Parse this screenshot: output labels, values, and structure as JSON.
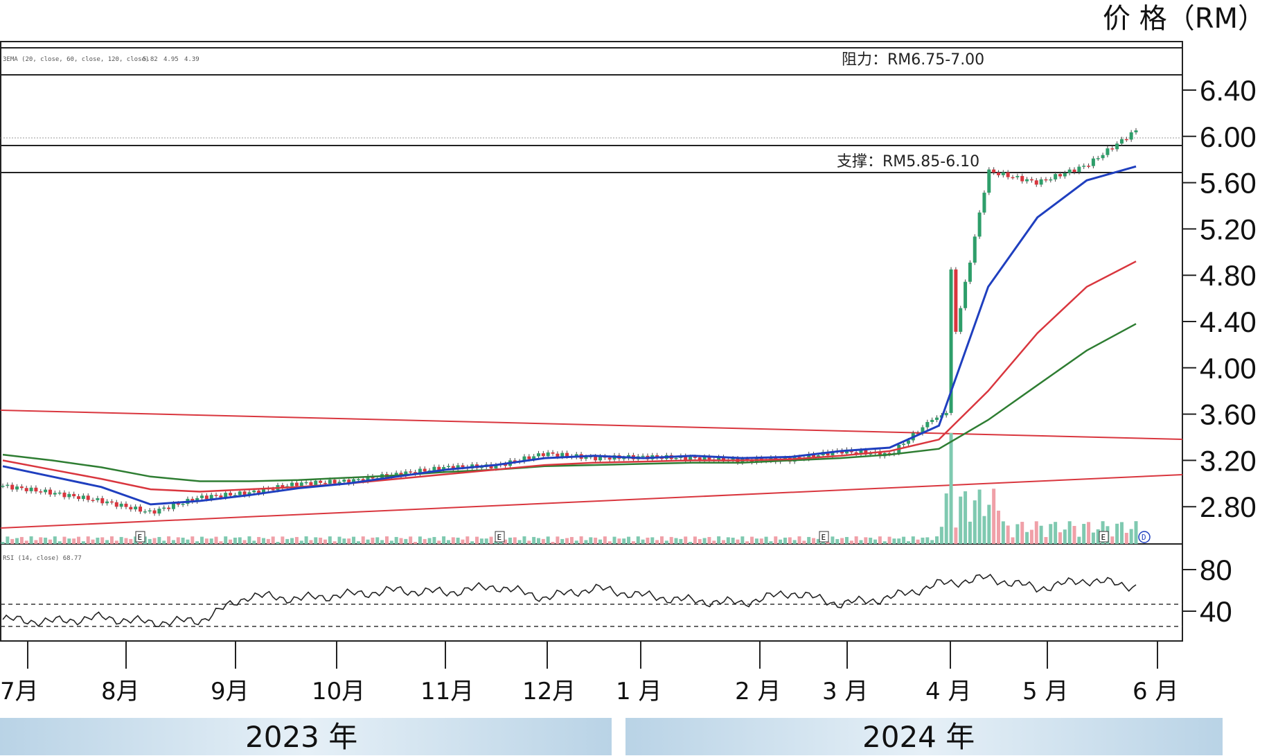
{
  "chart_data": {
    "type": "candlestick",
    "ylabel": "价 格（RM）",
    "y_ticks": [
      "6.40",
      "6.00",
      "5.60",
      "5.20",
      "4.80",
      "4.40",
      "4.00",
      "3.60",
      "3.20",
      "2.80"
    ],
    "rsi_ticks": [
      "80",
      "40"
    ],
    "rsi_legend": "RSI (14, close) 68.77",
    "ema_legend": {
      "text": "3EMA (20, close, 60, close, 120, close)",
      "v1": "5.82",
      "v2": "4.95",
      "v3": "4.39"
    },
    "resistance": {
      "label": "阻力：RM6.75-7.00",
      "low": 6.75,
      "high": 7.0
    },
    "support": {
      "label": "支撑：RM5.85-6.10",
      "low": 5.85,
      "high": 6.1
    },
    "months": [
      "7月",
      "8月",
      "9月",
      "10月",
      "11月",
      "12月",
      "1 月",
      "2 月",
      "3 月",
      "4 月",
      "5 月",
      "6 月"
    ],
    "years": [
      "2023 年",
      "2024 年"
    ],
    "earnings_marker": "E",
    "dividend_marker": "D",
    "colors": {
      "up": "#2e9e6a",
      "down": "#d9363e",
      "ema20": "#1f3fbf",
      "ema60": "#d9363e",
      "ema120": "#2e7d32",
      "volume_up": "#7fc9b0",
      "volume_down": "#f0a0a8",
      "year_band": "#b9d3e6"
    },
    "ema20_values": [
      3.15,
      3.06,
      2.97,
      2.82,
      2.85,
      2.9,
      2.96,
      3.0,
      3.06,
      3.12,
      3.16,
      3.22,
      3.24,
      3.22,
      3.24,
      3.22,
      3.23,
      3.28,
      3.31,
      3.5,
      4.7,
      5.3,
      5.62,
      5.74
    ],
    "ema60_values": [
      3.2,
      3.12,
      3.04,
      2.95,
      2.93,
      2.95,
      2.97,
      3.0,
      3.04,
      3.08,
      3.12,
      3.16,
      3.18,
      3.19,
      3.2,
      3.2,
      3.21,
      3.24,
      3.28,
      3.38,
      3.8,
      4.3,
      4.7,
      4.92
    ],
    "ema120_values": [
      3.25,
      3.2,
      3.14,
      3.06,
      3.02,
      3.02,
      3.03,
      3.05,
      3.07,
      3.1,
      3.12,
      3.15,
      3.16,
      3.17,
      3.18,
      3.18,
      3.2,
      3.22,
      3.25,
      3.3,
      3.55,
      3.85,
      4.15,
      4.38
    ],
    "rsi_values": [
      32,
      30,
      34,
      29,
      31,
      55,
      52,
      56,
      60,
      58,
      64,
      53,
      62,
      55,
      50,
      48,
      58,
      47,
      53,
      66,
      72,
      62,
      70,
      64
    ],
    "closes": [
      2.98,
      2.92,
      2.85,
      2.75,
      2.88,
      2.92,
      3.0,
      3.02,
      3.08,
      3.14,
      3.15,
      3.26,
      3.22,
      3.23,
      3.22,
      3.2,
      3.21,
      3.28,
      3.25,
      3.6,
      5.7,
      5.6,
      5.75,
      6.05
    ]
  }
}
